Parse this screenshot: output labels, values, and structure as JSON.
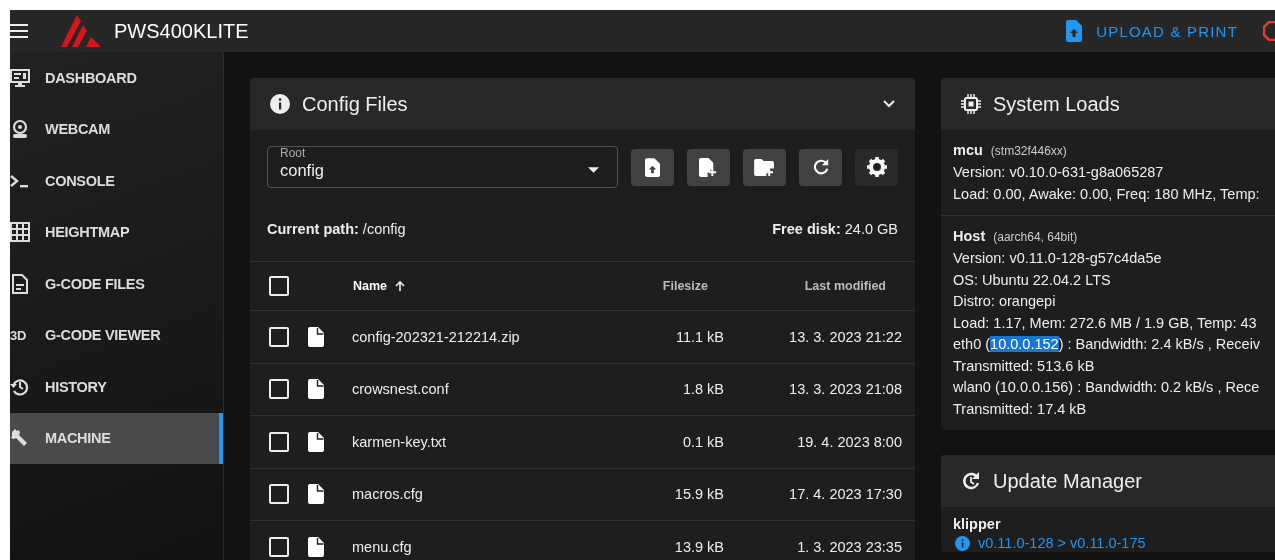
{
  "app": {
    "title": "PWS400KLITE",
    "upload_button": "UPLOAD & PRINT"
  },
  "sidebar": {
    "items": [
      {
        "label": "DASHBOARD",
        "kind": "monitor",
        "selected": false
      },
      {
        "label": "WEBCAM",
        "kind": "webcam",
        "selected": false
      },
      {
        "label": "CONSOLE",
        "kind": "console",
        "selected": false
      },
      {
        "label": "HEIGHTMAP",
        "kind": "grid",
        "selected": false
      },
      {
        "label": "G-CODE FILES",
        "kind": "file",
        "selected": false
      },
      {
        "label": "G-CODE VIEWER",
        "kind": "glyph",
        "glyph": "3D",
        "selected": false
      },
      {
        "label": "HISTORY",
        "kind": "history",
        "selected": false
      },
      {
        "label": "MACHINE",
        "kind": "wrench",
        "selected": true
      }
    ]
  },
  "config_files": {
    "title": "Config Files",
    "root_select": {
      "label": "Root",
      "value": "config"
    },
    "current_path": {
      "label": "Current path:",
      "value": "/config"
    },
    "free_disk": {
      "label": "Free disk:",
      "value": "24.0 GB"
    },
    "table": {
      "all_checked": false,
      "columns": [
        {
          "label": "Name",
          "sorted": true
        },
        {
          "label": "Filesize",
          "sorted": false
        },
        {
          "label": "Last modified",
          "sorted": false
        }
      ],
      "rows": [
        {
          "name": "config-202321-212214.zip",
          "size": "11.1 kB",
          "modified": "13. 3. 2023 21:22",
          "checked": false
        },
        {
          "name": "crowsnest.conf",
          "size": "1.8 kB",
          "modified": "13. 3. 2023 21:08",
          "checked": false
        },
        {
          "name": "karmen-key.txt",
          "size": "0.1 kB",
          "modified": "19. 4. 2023 8:00",
          "checked": false
        },
        {
          "name": "macros.cfg",
          "size": "15.9 kB",
          "modified": "17. 4. 2023 17:30",
          "checked": false
        },
        {
          "name": "menu.cfg",
          "size": "13.9 kB",
          "modified": "1. 3. 2023 23:35",
          "checked": false
        }
      ]
    }
  },
  "system_loads": {
    "title": "System Loads",
    "sections": [
      {
        "name": "mcu",
        "detail": "(stm32f446xx)",
        "lines": [
          {
            "parts": [
              {
                "text": "Version: v0.10.0-631-g8a065287",
                "selected": false
              }
            ]
          },
          {
            "parts": [
              {
                "text": "Load: 0.00, Awake: 0.00, Freq: 180 MHz, Temp:",
                "selected": false
              }
            ]
          }
        ]
      },
      {
        "name": "Host",
        "detail": "(aarch64, 64bit)",
        "lines": [
          {
            "parts": [
              {
                "text": "Version: v0.11.0-128-g57c4da5e",
                "selected": false
              }
            ]
          },
          {
            "parts": [
              {
                "text": "OS: Ubuntu 22.04.2 LTS",
                "selected": false
              }
            ]
          },
          {
            "parts": [
              {
                "text": "Distro: orangepi",
                "selected": false
              }
            ]
          },
          {
            "parts": [
              {
                "text": "Load: 1.17, Mem: 272.6 MB / 1.9 GB, Temp: 43",
                "selected": false
              }
            ]
          },
          {
            "parts": [
              {
                "text": "eth0 (",
                "selected": false
              },
              {
                "text": "10.0.0.152",
                "selected": true
              },
              {
                "text": ") : Bandwidth: 2.4 kB/s , Receiv",
                "selected": false
              }
            ]
          },
          {
            "parts": [
              {
                "text": "Transmitted: 513.6 kB",
                "selected": false
              }
            ]
          },
          {
            "parts": [
              {
                "text": "wlan0 (10.0.0.156) : Bandwidth: 0.2 kB/s , Rece",
                "selected": false
              }
            ]
          },
          {
            "parts": [
              {
                "text": "Transmitted: 17.4 kB",
                "selected": false
              }
            ]
          }
        ]
      }
    ]
  },
  "update_manager": {
    "title": "Update Manager",
    "items": [
      {
        "name": "klipper",
        "version": "v0.11.0-128 > v0.11.0-175"
      }
    ]
  }
}
